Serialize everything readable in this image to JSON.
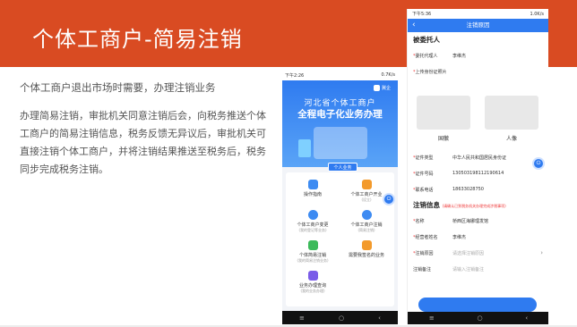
{
  "slide": {
    "title": "个体工商户-简易注销",
    "subtitle": "个体工商户退出市场时需要，办理注销业务",
    "body": "办理简易注销，审批机关同意注销后会，向税务推送个体工商户的简易注销信息，税务反馈无异议后，审批机关可直接注销个体工商户，并将注销结果推送至税务后，税务同步完成税务注销。"
  },
  "phone1": {
    "status_time": "下午2:26",
    "status_speed": "0.7K/s",
    "logo_label": "冀企",
    "hero_line1": "河北省个体工商户",
    "hero_line2": "全程电子化业务办理",
    "tab_label": "个人业务",
    "items": [
      {
        "label": "操作指南",
        "sub": ""
      },
      {
        "label": "个体工商户开业",
        "sub": "(设立)"
      },
      {
        "label": "个体工商户变更",
        "sub": "(我的登记等业务)"
      },
      {
        "label": "个体工商户注销",
        "sub": "(简易注销)"
      },
      {
        "label": "个体简易注销",
        "sub": "(我的简易注销业务)"
      },
      {
        "label": "需要我签名的业务",
        "sub": ""
      },
      {
        "label": "业务办理查询",
        "sub": "(我的业务办理)"
      }
    ],
    "nav": [
      "≡",
      "○",
      "‹"
    ]
  },
  "phone2": {
    "status_time": "下午5:36",
    "status_speed": "1.0K/s",
    "title": "注销原因",
    "section1": "被委托人",
    "agent_label": "委托代理人",
    "agent_value": "李维杰",
    "upload_label": "上传身份证照片",
    "card_front": "国徽",
    "card_back": "人像",
    "idtype_label": "证件类型",
    "idtype_value": "中华人民共和国居民身份证",
    "idno_label": "证件号码",
    "idno_value": "130503198112190614",
    "phone_label": "联系电话",
    "phone_value": "18633028750",
    "section2": "注销信息",
    "section2_note": "(请确认已到税务机关办理完成涉税事项)",
    "name_label": "名称",
    "name_value": "桥西区海娜理发馆",
    "operator_label": "经营者姓名",
    "operator_value": "李维杰",
    "reason_label": "注销原因",
    "reason_placeholder": "请选择注销原因",
    "remark_label": "注销备注",
    "remark_placeholder": "请输入注销备注",
    "nav": [
      "≡",
      "○",
      "‹"
    ]
  },
  "colors": {
    "banner": "#d94b22",
    "accent": "#2f7bf0"
  }
}
